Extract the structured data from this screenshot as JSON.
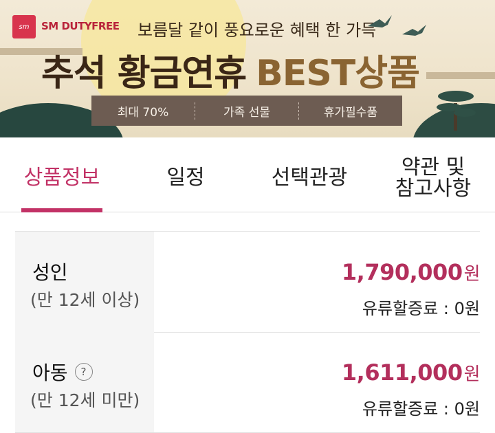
{
  "banner": {
    "logo_mark": "sm",
    "logo_text": "SM DUTYFREE",
    "subtitle": "보름달 같이 풍요로운 혜택 한 가득",
    "title_main": "추석 황금연휴",
    "title_best": "BEST상품",
    "tags": [
      "최대 70%",
      "가족 선물",
      "휴가필수품"
    ]
  },
  "tabs": [
    {
      "label": "상품정보",
      "active": true
    },
    {
      "label": "일정",
      "active": false
    },
    {
      "label": "선택관광",
      "active": false
    },
    {
      "label": "약관 및\n참고사항",
      "active": false
    }
  ],
  "prices": [
    {
      "name": "성인",
      "condition": "(만 12세 이상)",
      "amount": "1,790,000",
      "unit": "원",
      "surcharge": "유류할증료 : 0원",
      "has_help": false
    },
    {
      "name": "아동",
      "condition": "(만 12세 미만)",
      "amount": "1,611,000",
      "unit": "원",
      "surcharge": "유류할증료 : 0원",
      "has_help": true,
      "help_symbol": "?"
    }
  ],
  "colors": {
    "accent": "#c23266",
    "price": "#b32f5c",
    "tagbar": "#6d5c52"
  }
}
